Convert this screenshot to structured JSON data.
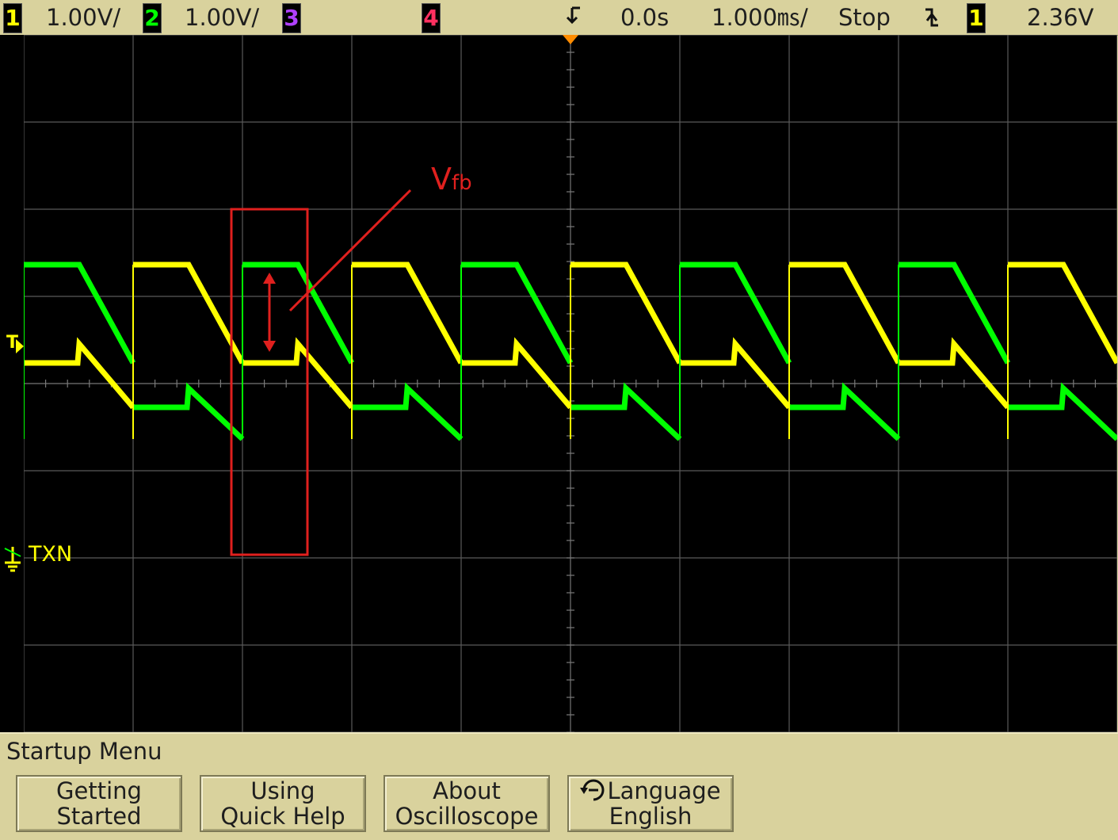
{
  "status_bar": {
    "ch1": {
      "num": "1",
      "scale": "1.00V/",
      "color": "#ffff00"
    },
    "ch2": {
      "num": "2",
      "scale": "1.00V/",
      "color": "#00ff00"
    },
    "ch3": {
      "num": "3",
      "color": "#b040ff"
    },
    "ch4": {
      "num": "4",
      "color": "#ff3060"
    },
    "delay": "0.0s",
    "timebase": "1.000㎳/",
    "run_state": "Stop",
    "trigger_slope_icon": "falling-edge",
    "trigger_source": "1",
    "trigger_level": "2.36V"
  },
  "screen": {
    "ground_label": "TXN",
    "trigger_marker": "T",
    "annotation_label_main": "V",
    "annotation_label_sub": "fb",
    "annotation_color": "#e0201e",
    "trace_ch1_color": "#ffff00",
    "trace_ch2_color": "#00ff00"
  },
  "menu": {
    "title": "Startup Menu",
    "buttons": [
      {
        "line1": "Getting",
        "line2": "Started"
      },
      {
        "line1": "Using",
        "line2": "Quick Help"
      },
      {
        "line1": "About",
        "line2": "Oscilloscope"
      },
      {
        "line1": "Language",
        "line2": "English",
        "icon": "rotate-knob-icon"
      }
    ]
  }
}
